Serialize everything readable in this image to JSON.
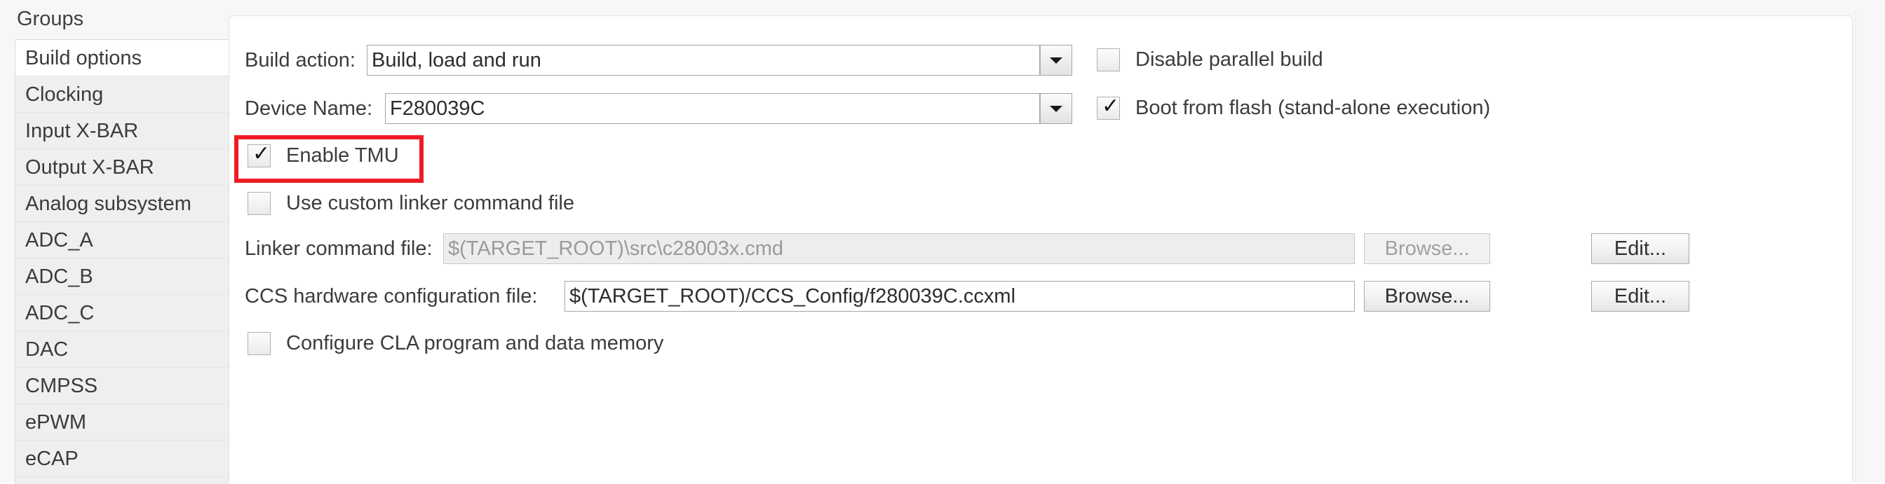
{
  "groups": {
    "header": "Groups",
    "items": [
      {
        "label": "Build options",
        "selected": true
      },
      {
        "label": "Clocking",
        "selected": false
      },
      {
        "label": "Input X-BAR",
        "selected": false
      },
      {
        "label": "Output X-BAR",
        "selected": false
      },
      {
        "label": "Analog subsystem",
        "selected": false
      },
      {
        "label": "ADC_A",
        "selected": false
      },
      {
        "label": "ADC_B",
        "selected": false
      },
      {
        "label": "ADC_C",
        "selected": false
      },
      {
        "label": "DAC",
        "selected": false
      },
      {
        "label": "CMPSS",
        "selected": false
      },
      {
        "label": "ePWM",
        "selected": false
      },
      {
        "label": "eCAP",
        "selected": false
      }
    ]
  },
  "build_options": {
    "build_action": {
      "label": "Build action:",
      "value": "Build, load and run",
      "options": [
        "Build, load and run"
      ]
    },
    "disable_parallel_build": {
      "label": "Disable parallel build",
      "checked": false,
      "mark": ""
    },
    "device_name": {
      "label": "Device Name:",
      "value": "F280039C",
      "options": [
        "F280039C"
      ]
    },
    "boot_from_flash": {
      "label": "Boot from flash (stand-alone execution)",
      "checked": true,
      "mark": "✓"
    },
    "enable_tmu": {
      "label": "Enable TMU",
      "checked": true,
      "mark": "✓",
      "highlight_color": "#ee1b24"
    },
    "use_custom_linker": {
      "label": "Use custom linker command file",
      "checked": false,
      "mark": ""
    },
    "linker_command_file": {
      "label": "Linker command file:",
      "value": "$(TARGET_ROOT)\\src\\c28003x.cmd",
      "enabled": false,
      "browse_label": "Browse...",
      "edit_label": "Edit..."
    },
    "ccs_hardware_config_file": {
      "label": "CCS hardware configuration file:",
      "value": "$(TARGET_ROOT)/CCS_Config/f280039C.ccxml",
      "enabled": true,
      "browse_label": "Browse...",
      "edit_label": "Edit..."
    },
    "configure_cla": {
      "label": "Configure CLA program and data memory",
      "checked": false,
      "mark": ""
    }
  }
}
